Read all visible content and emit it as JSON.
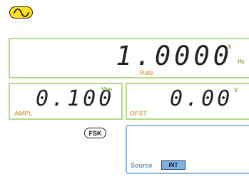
{
  "waveform": {
    "icon": "sine-wave-icon",
    "color": "#ffe01b"
  },
  "rate_display": {
    "value": "1.0000",
    "unit_prefix": "k",
    "unit": "Hz",
    "label": "Rate"
  },
  "ampl_display": {
    "value": "0.100",
    "unit": "Vpp",
    "label": "AMPL"
  },
  "ofst_display": {
    "value": "0.00",
    "unit": "V",
    "label": "OFST"
  },
  "fsk_button": {
    "label": "FSK"
  },
  "source": {
    "label": "Source",
    "value": "INT"
  },
  "colors": {
    "panel_border": "#b3d98a",
    "label": "#e0a84e",
    "unit": "#7aaa4a",
    "source_border": "#8fbbe0",
    "badge_fill": "#7fb2e0"
  }
}
